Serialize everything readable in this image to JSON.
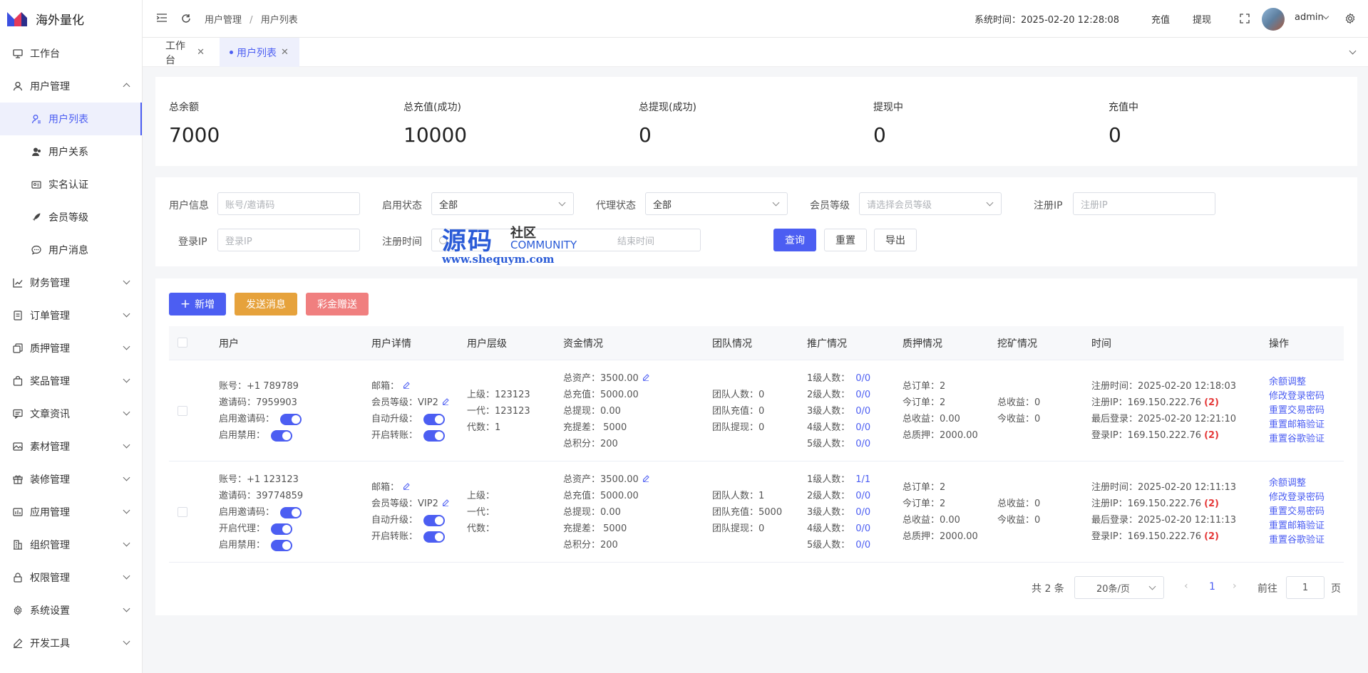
{
  "app": {
    "title": "海外量化"
  },
  "sidebar": {
    "items": [
      {
        "label": "工作台",
        "icon": "monitor-icon"
      },
      {
        "label": "用户管理",
        "icon": "user-icon"
      },
      {
        "label": "用户列表",
        "icon": "user-list-icon"
      },
      {
        "label": "用户关系",
        "icon": "user-relation-icon"
      },
      {
        "label": "实名认证",
        "icon": "id-card-icon"
      },
      {
        "label": "会员等级",
        "icon": "rocket-icon"
      },
      {
        "label": "用户消息",
        "icon": "message-icon"
      },
      {
        "label": "财务管理",
        "icon": "chart-icon"
      },
      {
        "label": "订单管理",
        "icon": "order-icon"
      },
      {
        "label": "质押管理",
        "icon": "copy-icon"
      },
      {
        "label": "奖品管理",
        "icon": "bag-icon"
      },
      {
        "label": "文章资讯",
        "icon": "comment-icon"
      },
      {
        "label": "素材管理",
        "icon": "picture-icon"
      },
      {
        "label": "装修管理",
        "icon": "gift-icon"
      },
      {
        "label": "应用管理",
        "icon": "app-icon"
      },
      {
        "label": "组织管理",
        "icon": "org-icon"
      },
      {
        "label": "权限管理",
        "icon": "lock-icon"
      },
      {
        "label": "系统设置",
        "icon": "gear-icon"
      },
      {
        "label": "开发工具",
        "icon": "pen-icon"
      }
    ]
  },
  "header": {
    "breadcrumb_1": "用户管理",
    "breadcrumb_sep": "/",
    "breadcrumb_2": "用户列表",
    "system_time": "系统时间：2025-02-20 12:28:08",
    "recharge": "充值",
    "withdraw": "提现",
    "username": "admin"
  },
  "tabs": [
    {
      "label": "工作台"
    },
    {
      "label": "用户列表"
    }
  ],
  "stats": [
    {
      "label": "总余额",
      "value": "7000"
    },
    {
      "label": "总充值(成功)",
      "value": "10000"
    },
    {
      "label": "总提现(成功)",
      "value": "0"
    },
    {
      "label": "提现中",
      "value": "0"
    },
    {
      "label": "充值中",
      "value": "0"
    }
  ],
  "filters": {
    "user_info_label": "用户信息",
    "user_info_placeholder": "账号/邀请码",
    "enable_label": "启用状态",
    "enable_value": "全部",
    "agent_label": "代理状态",
    "agent_value": "全部",
    "level_label": "会员等级",
    "level_placeholder": "请选择会员等级",
    "reg_ip_label": "注册IP",
    "reg_ip_placeholder": "注册IP",
    "login_ip_label": "登录IP",
    "login_ip_placeholder": "登录IP",
    "reg_time_label": "注册时间",
    "end_time_placeholder": "结束时间",
    "query": "查询",
    "reset": "重置",
    "export": "导出"
  },
  "watermark": {
    "main": "源码",
    "community_cn": "社区",
    "community_en": "COMMUNITY",
    "url": "www.shequym.com"
  },
  "actions": {
    "add": "新增",
    "send_msg": "发送消息",
    "gift": "彩金赠送"
  },
  "table": {
    "headers": [
      "用户",
      "用户详情",
      "用户层级",
      "资金情况",
      "团队情况",
      "推广情况",
      "质押情况",
      "挖矿情况",
      "时间",
      "操作"
    ],
    "rows": [
      {
        "user": [
          "账号：+1 789789",
          "邀请码：7959903",
          "启用邀请码：",
          "启用禁用："
        ],
        "detail": [
          "邮箱：",
          "会员等级：VIP2",
          "自动升级：",
          "开启转账："
        ],
        "level": [
          "上级：123123",
          "一代：123123",
          "代数：1"
        ],
        "funds": [
          "总资产：3500.00",
          "总充值：5000.00",
          "总提现：0.00",
          "充提差：  5000",
          "总积分：200"
        ],
        "team": [
          "团队人数：0",
          "团队充值：0",
          "团队提现：0"
        ],
        "promo_labels": [
          "1级人数：",
          "2级人数：",
          "3级人数：",
          "4级人数：",
          "5级人数："
        ],
        "promo_values": [
          "0/0",
          "0/0",
          "0/0",
          "0/0",
          "0/0"
        ],
        "pledge": [
          "总订单：2",
          "今订单：2",
          "总收益：0.00",
          "总质押：2000.00"
        ],
        "mining": [
          "总收益：0",
          "今收益：0"
        ],
        "time": [
          "注册时间：2025-02-20 12:18:03",
          "注册IP：169.150.222.76",
          "最后登录：2025-02-20 12:21:10",
          "登录IP：169.150.222.76"
        ],
        "ip_count": "(2)",
        "ops": [
          "余额调整",
          "修改登录密码",
          "重置交易密码",
          "重置邮箱验证",
          "重置谷歌验证"
        ]
      },
      {
        "user": [
          "账号：+1 123123",
          "邀请码：39774859",
          "启用邀请码：",
          "开启代理：",
          "启用禁用："
        ],
        "detail": [
          "邮箱：",
          "会员等级：VIP2",
          "自动升级：",
          "开启转账："
        ],
        "level": [
          "上级：",
          "一代：",
          "代数："
        ],
        "funds": [
          "总资产：3500.00",
          "总充值：5000.00",
          "总提现：0.00",
          "充提差：  5000",
          "总积分：200"
        ],
        "team": [
          "团队人数：1",
          "团队充值：5000",
          "团队提现：0"
        ],
        "promo_labels": [
          "1级人数：",
          "2级人数：",
          "3级人数：",
          "4级人数：",
          "5级人数："
        ],
        "promo_values": [
          "1/1",
          "0/0",
          "0/0",
          "0/0",
          "0/0"
        ],
        "pledge": [
          "总订单：2",
          "今订单：2",
          "总收益：0.00",
          "总质押：2000.00"
        ],
        "mining": [
          "总收益：0",
          "今收益：0"
        ],
        "time": [
          "注册时间：2025-02-20 12:11:13",
          "注册IP：169.150.222.76",
          "最后登录：2025-02-20 12:11:13",
          "登录IP：169.150.222.76"
        ],
        "ip_count": "(2)",
        "ops": [
          "余额调整",
          "修改登录密码",
          "重置交易密码",
          "重置邮箱验证",
          "重置谷歌验证"
        ]
      }
    ]
  },
  "pagination": {
    "total": "共 2 条",
    "page_size": "20条/页",
    "current": "1",
    "goto": "前往",
    "goto_value": "1",
    "page_unit": "页"
  },
  "colors": {
    "accent": "#4c5ef2",
    "warning": "#e6a23c",
    "danger": "#f07f7f"
  }
}
